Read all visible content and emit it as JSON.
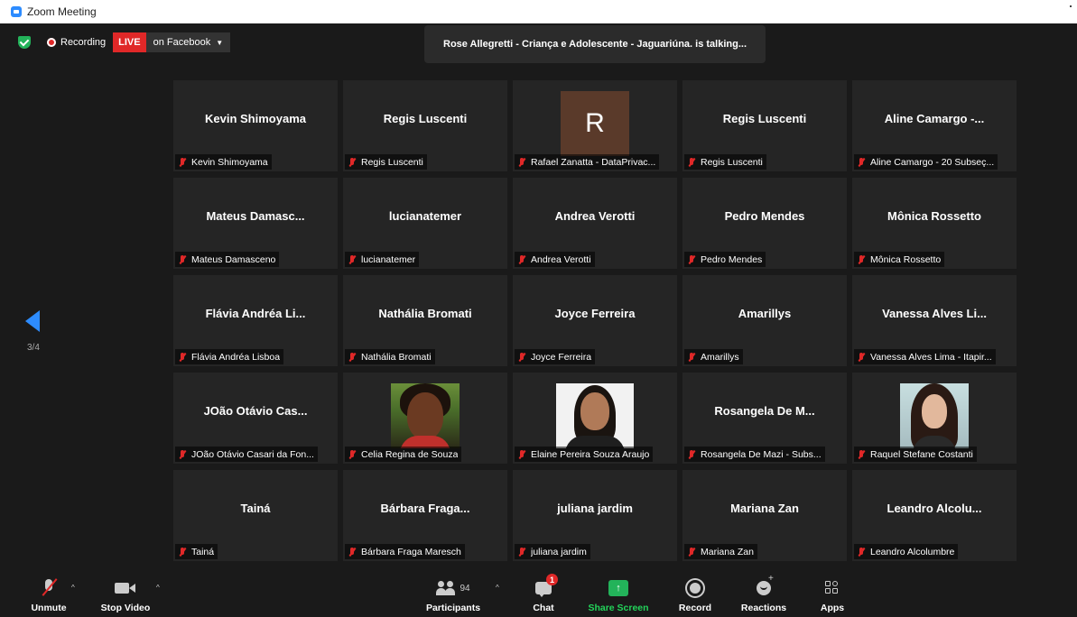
{
  "window": {
    "title": "Zoom Meeting"
  },
  "status": {
    "recording_label": "Recording",
    "live_label": "LIVE",
    "live_destination": "on Facebook",
    "speaker_text": "Rose Allegretti - Criança e Adolescente - Jaguariúna. is talking..."
  },
  "pager": {
    "indicator": "3/4"
  },
  "tiles": [
    {
      "big": "Kevin Shimoyama",
      "label": "Kevin Shimoyama"
    },
    {
      "big": "Regis Luscenti",
      "label": "Regis Luscenti"
    },
    {
      "big": "R",
      "label": "Rafael Zanatta - DataPrivac..."
    },
    {
      "big": "Regis Luscenti",
      "label": "Regis Luscenti"
    },
    {
      "big": "Aline Camargo -...",
      "label": "Aline Camargo - 20 Subseç..."
    },
    {
      "big": "Mateus Damasc...",
      "label": "Mateus Damasceno"
    },
    {
      "big": "lucianatemer",
      "label": "lucianatemer"
    },
    {
      "big": "Andrea Verotti",
      "label": "Andrea Verotti"
    },
    {
      "big": "Pedro Mendes",
      "label": "Pedro Mendes"
    },
    {
      "big": "Mônica Rossetto",
      "label": "Mônica Rossetto"
    },
    {
      "big": "Flávia Andréa Li...",
      "label": "Flávia Andréa Lisboa"
    },
    {
      "big": "Nathália Bromati",
      "label": "Nathália Bromati"
    },
    {
      "big": "Joyce Ferreira",
      "label": "Joyce Ferreira"
    },
    {
      "big": "Amarillys",
      "label": "Amarillys"
    },
    {
      "big": "Vanessa Alves Li...",
      "label": "Vanessa Alves Lima - Itapir..."
    },
    {
      "big": "JOão Otávio Cas...",
      "label": "JOão Otávio Casari da Fon..."
    },
    {
      "big": "",
      "label": "Celia Regina de Souza"
    },
    {
      "big": "",
      "label": "Elaine Pereira Souza Araujo"
    },
    {
      "big": "Rosangela De M...",
      "label": "Rosangela De Mazi - Subs..."
    },
    {
      "big": "",
      "label": "Raquel Stefane Costanti"
    },
    {
      "big": "Tainá",
      "label": "Tainá"
    },
    {
      "big": "Bárbara Fraga...",
      "label": "Bárbara Fraga Maresch"
    },
    {
      "big": "juliana jardim",
      "label": "juliana jardim"
    },
    {
      "big": "Mariana Zan",
      "label": "Mariana Zan"
    },
    {
      "big": "Leandro Alcolu...",
      "label": "Leandro Alcolumbre"
    }
  ],
  "toolbar": {
    "unmute": "Unmute",
    "stop_video": "Stop Video",
    "participants": "Participants",
    "participants_count": "94",
    "chat": "Chat",
    "chat_badge": "1",
    "share_screen": "Share Screen",
    "record": "Record",
    "reactions": "Reactions",
    "apps": "Apps"
  },
  "colors": {
    "accent": "#2d8cff",
    "live_red": "#e02828",
    "share_green": "#23b35a",
    "background": "#1a1a1a",
    "tile": "#252525"
  }
}
